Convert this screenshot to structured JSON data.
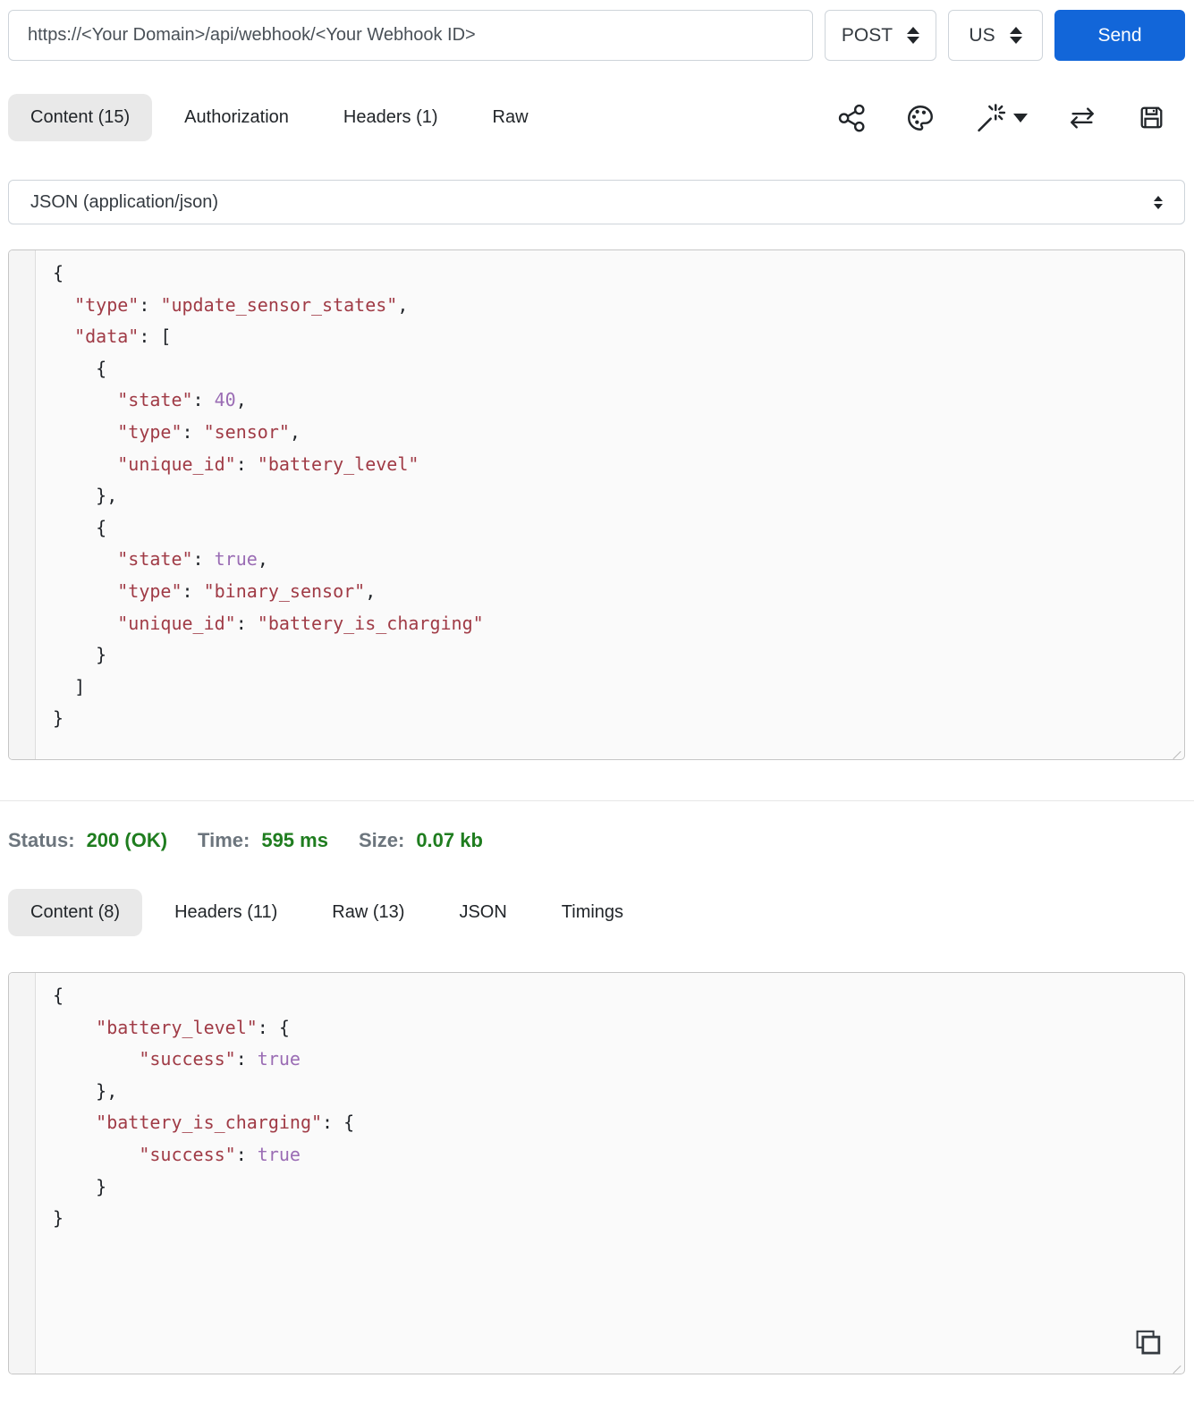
{
  "request_bar": {
    "url_value": "https://<Your Domain>/api/webhook/<Your Webhook ID>",
    "method_selected": "POST",
    "region_selected": "US",
    "send_label": "Send"
  },
  "request_tabs": [
    {
      "name": "tab-request-content",
      "label": "Content (15)",
      "active": true
    },
    {
      "name": "tab-request-authorization",
      "label": "Authorization",
      "active": false
    },
    {
      "name": "tab-request-headers",
      "label": "Headers (1)",
      "active": false
    },
    {
      "name": "tab-request-raw",
      "label": "Raw",
      "active": false
    }
  ],
  "toolbar_icons": [
    "share-icon",
    "palette-icon",
    "magic-wand-icon",
    "swap-arrows-icon",
    "save-icon"
  ],
  "content_type": {
    "selected": "JSON (application/json)"
  },
  "request_body_lines": [
    [
      [
        "p",
        "{"
      ]
    ],
    [
      [
        "p",
        "  "
      ],
      [
        "k",
        "\"type\""
      ],
      [
        "p",
        ": "
      ],
      [
        "k",
        "\"update_sensor_states\""
      ],
      [
        "p",
        ","
      ]
    ],
    [
      [
        "p",
        "  "
      ],
      [
        "k",
        "\"data\""
      ],
      [
        "p",
        ": ["
      ]
    ],
    [
      [
        "p",
        "    {"
      ]
    ],
    [
      [
        "p",
        "      "
      ],
      [
        "k",
        "\"state\""
      ],
      [
        "p",
        ": "
      ],
      [
        "a",
        "40"
      ],
      [
        "p",
        ","
      ]
    ],
    [
      [
        "p",
        "      "
      ],
      [
        "k",
        "\"type\""
      ],
      [
        "p",
        ": "
      ],
      [
        "k",
        "\"sensor\""
      ],
      [
        "p",
        ","
      ]
    ],
    [
      [
        "p",
        "      "
      ],
      [
        "k",
        "\"unique_id\""
      ],
      [
        "p",
        ": "
      ],
      [
        "k",
        "\"battery_level\""
      ]
    ],
    [
      [
        "p",
        "    },"
      ]
    ],
    [
      [
        "p",
        "    {"
      ]
    ],
    [
      [
        "p",
        "      "
      ],
      [
        "k",
        "\"state\""
      ],
      [
        "p",
        ": "
      ],
      [
        "a",
        "true"
      ],
      [
        "p",
        ","
      ]
    ],
    [
      [
        "p",
        "      "
      ],
      [
        "k",
        "\"type\""
      ],
      [
        "p",
        ": "
      ],
      [
        "k",
        "\"binary_sensor\""
      ],
      [
        "p",
        ","
      ]
    ],
    [
      [
        "p",
        "      "
      ],
      [
        "k",
        "\"unique_id\""
      ],
      [
        "p",
        ": "
      ],
      [
        "k",
        "\"battery_is_charging\""
      ]
    ],
    [
      [
        "p",
        "    }"
      ]
    ],
    [
      [
        "p",
        "  ]"
      ]
    ],
    [
      [
        "p",
        "}"
      ]
    ]
  ],
  "response_status": {
    "status_label": "Status:",
    "status_value": "200 (OK)",
    "time_label": "Time:",
    "time_value": "595 ms",
    "size_label": "Size:",
    "size_value": "0.07 kb"
  },
  "response_tabs": [
    {
      "name": "tab-response-content",
      "label": "Content (8)",
      "active": true
    },
    {
      "name": "tab-response-headers",
      "label": "Headers (11)",
      "active": false
    },
    {
      "name": "tab-response-raw",
      "label": "Raw (13)",
      "active": false
    },
    {
      "name": "tab-response-json",
      "label": "JSON",
      "active": false
    },
    {
      "name": "tab-response-timings",
      "label": "Timings",
      "active": false
    }
  ],
  "response_body_lines": [
    [
      [
        "p",
        "{"
      ]
    ],
    [
      [
        "p",
        "    "
      ],
      [
        "k",
        "\"battery_level\""
      ],
      [
        "p",
        ": {"
      ]
    ],
    [
      [
        "p",
        "        "
      ],
      [
        "k",
        "\"success\""
      ],
      [
        "p",
        ": "
      ],
      [
        "a",
        "true"
      ]
    ],
    [
      [
        "p",
        "    },"
      ]
    ],
    [
      [
        "p",
        "    "
      ],
      [
        "k",
        "\"battery_is_charging\""
      ],
      [
        "p",
        ": {"
      ]
    ],
    [
      [
        "p",
        "        "
      ],
      [
        "k",
        "\"success\""
      ],
      [
        "p",
        ": "
      ],
      [
        "a",
        "true"
      ]
    ],
    [
      [
        "p",
        "    }"
      ]
    ],
    [
      [
        "p",
        "}"
      ]
    ]
  ],
  "colors": {
    "accent_blue": "#1266d9",
    "json_string": "#a03b46",
    "json_atom": "#9a6cb4",
    "status_green": "#1f7d1f",
    "active_tab_bg": "#e9e9e9"
  }
}
